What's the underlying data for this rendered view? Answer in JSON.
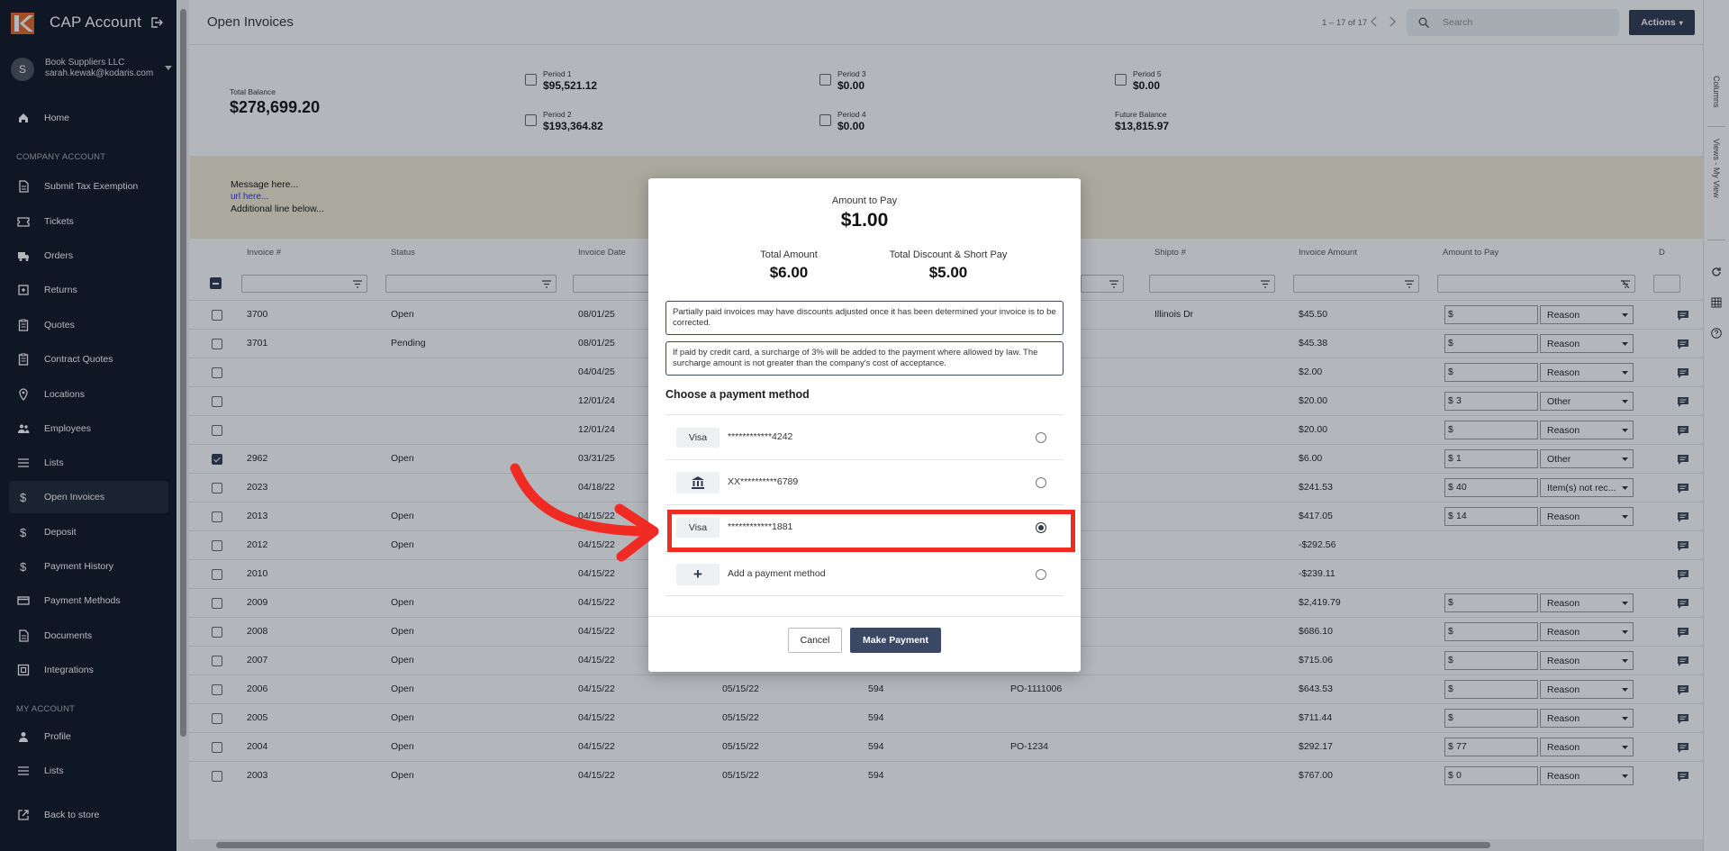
{
  "sidebar": {
    "app_title": "CAP Account",
    "account_name": "Book Suppliers LLC",
    "account_email": "sarah.kewak@kodaris.com",
    "avatar_letter": "S",
    "section_company": "COMPANY ACCOUNT",
    "section_my": "MY ACCOUNT",
    "items": [
      {
        "label": "Home",
        "icon": "home-icon"
      },
      {
        "label": "Submit Tax Exemption",
        "icon": "document-icon"
      },
      {
        "label": "Tickets",
        "icon": "ticket-icon"
      },
      {
        "label": "Orders",
        "icon": "truck-icon"
      },
      {
        "label": "Returns",
        "icon": "return-box-icon"
      },
      {
        "label": "Quotes",
        "icon": "clipboard-icon"
      },
      {
        "label": "Contract Quotes",
        "icon": "clipboard-icon"
      },
      {
        "label": "Locations",
        "icon": "location-pin-icon"
      },
      {
        "label": "Employees",
        "icon": "people-icon"
      },
      {
        "label": "Lists",
        "icon": "list-icon"
      },
      {
        "label": "Open Invoices",
        "icon": "dollar-icon"
      },
      {
        "label": "Deposit",
        "icon": "dollar-icon"
      },
      {
        "label": "Payment History",
        "icon": "dollar-icon"
      },
      {
        "label": "Payment Methods",
        "icon": "credit-card-icon"
      },
      {
        "label": "Documents",
        "icon": "document-icon"
      },
      {
        "label": "Integrations",
        "icon": "integration-icon"
      }
    ],
    "my_items": [
      {
        "label": "Profile",
        "icon": "person-icon"
      },
      {
        "label": "Lists",
        "icon": "list-icon"
      }
    ],
    "back_to_store": "Back to store",
    "active_item": "Open Invoices"
  },
  "header": {
    "title": "Open Invoices",
    "pager": "1 – 17 of 17",
    "search_placeholder": "Search",
    "actions_label": "Actions"
  },
  "summary": {
    "total_balance_label": "Total Balance",
    "total_balance": "$278,699.20",
    "period1_label": "Period 1",
    "period1": "$95,521.12",
    "period2_label": "Period 2",
    "period2": "$193,364.82",
    "period3_label": "Period 3",
    "period3": "$0.00",
    "period4_label": "Period 4",
    "period4": "$0.00",
    "period5_label": "Period 5",
    "period5": "$0.00",
    "future_label": "Future Balance",
    "future": "$13,815.97"
  },
  "banner": {
    "line1": "Message here...",
    "line2": "url here...",
    "line3": "Additional line below..."
  },
  "table": {
    "columns": [
      "Invoice #",
      "Status",
      "Invoice Date",
      "Shipto #",
      "Invoice Amount",
      "Amount to Pay",
      "D"
    ],
    "rows": [
      {
        "invoice": "3700",
        "status": "Open",
        "date": "08/01/25",
        "due": "",
        "terms": "",
        "po": "",
        "shipto": "Illinois Dr",
        "amount": "$45.50",
        "pay": "",
        "reason": "Reason",
        "checked": false,
        "has_pay": true
      },
      {
        "invoice": "3701",
        "status": "Pending",
        "date": "08/01/25",
        "due": "",
        "terms": "",
        "po": "",
        "shipto": "",
        "amount": "$45.38",
        "pay": "",
        "reason": "Reason",
        "checked": false,
        "has_pay": true
      },
      {
        "invoice": "",
        "status": "",
        "date": "04/04/25",
        "due": "",
        "terms": "",
        "po": "",
        "shipto": "",
        "amount": "$2.00",
        "pay": "",
        "reason": "Reason",
        "checked": false,
        "has_pay": true
      },
      {
        "invoice": "",
        "status": "",
        "date": "12/01/24",
        "due": "",
        "terms": "",
        "po": "",
        "shipto": "",
        "amount": "$20.00",
        "pay": "3",
        "reason": "Other",
        "checked": false,
        "has_pay": true
      },
      {
        "invoice": "",
        "status": "",
        "date": "12/01/24",
        "due": "",
        "terms": "",
        "po": "",
        "shipto": "",
        "amount": "$20.00",
        "pay": "",
        "reason": "Reason",
        "checked": false,
        "has_pay": true
      },
      {
        "invoice": "2962",
        "status": "Open",
        "date": "03/31/25",
        "due": "",
        "terms": "",
        "po": "",
        "shipto": "",
        "amount": "$6.00",
        "pay": "1",
        "reason": "Other",
        "checked": true,
        "has_pay": true
      },
      {
        "invoice": "2023",
        "status": "",
        "date": "04/18/22",
        "due": "",
        "terms": "",
        "po": "",
        "shipto": "",
        "amount": "$241.53",
        "pay": "40",
        "reason": "Item(s) not rec...",
        "checked": false,
        "has_pay": true
      },
      {
        "invoice": "2013",
        "status": "Open",
        "date": "04/15/22",
        "due": "",
        "terms": "",
        "po": "",
        "shipto": "",
        "amount": "$417.05",
        "pay": "14",
        "reason": "Reason",
        "checked": false,
        "has_pay": true
      },
      {
        "invoice": "2012",
        "status": "Open",
        "date": "04/15/22",
        "due": "",
        "terms": "",
        "po": "",
        "shipto": "",
        "amount": "-$292.56",
        "pay": "",
        "reason": "",
        "checked": false,
        "has_pay": false
      },
      {
        "invoice": "2010",
        "status": "",
        "date": "04/15/22",
        "due": "",
        "terms": "",
        "po": "",
        "shipto": "",
        "amount": "-$239.11",
        "pay": "",
        "reason": "",
        "checked": false,
        "has_pay": false
      },
      {
        "invoice": "2009",
        "status": "Open",
        "date": "04/15/22",
        "due": "",
        "terms": "",
        "po": "",
        "shipto": "",
        "amount": "$2,419.79",
        "pay": "",
        "reason": "Reason",
        "checked": false,
        "has_pay": true
      },
      {
        "invoice": "2008",
        "status": "Open",
        "date": "04/15/22",
        "due": "",
        "terms": "",
        "po": "",
        "shipto": "",
        "amount": "$686.10",
        "pay": "",
        "reason": "Reason",
        "checked": false,
        "has_pay": true
      },
      {
        "invoice": "2007",
        "status": "Open",
        "date": "04/15/22",
        "due": "",
        "terms": "",
        "po": "",
        "shipto": "",
        "amount": "$715.06",
        "pay": "",
        "reason": "Reason",
        "checked": false,
        "has_pay": true
      },
      {
        "invoice": "2006",
        "status": "Open",
        "date": "04/15/22",
        "due": "05/15/22",
        "terms": "594",
        "po": "PO-1111006",
        "shipto": "",
        "amount": "$643.53",
        "pay": "",
        "reason": "Reason",
        "checked": false,
        "has_pay": true
      },
      {
        "invoice": "2005",
        "status": "Open",
        "date": "04/15/22",
        "due": "05/15/22",
        "terms": "594",
        "po": "",
        "shipto": "",
        "amount": "$711.44",
        "pay": "",
        "reason": "Reason",
        "checked": false,
        "has_pay": true
      },
      {
        "invoice": "2004",
        "status": "Open",
        "date": "04/15/22",
        "due": "05/15/22",
        "terms": "594",
        "po": "PO-1234",
        "shipto": "",
        "amount": "$292.17",
        "pay": "77",
        "reason": "Reason",
        "checked": false,
        "has_pay": true
      },
      {
        "invoice": "2003",
        "status": "Open",
        "date": "04/15/22",
        "due": "05/15/22",
        "terms": "594",
        "po": "",
        "shipto": "",
        "amount": "$767.00",
        "pay": "0",
        "reason": "Reason",
        "checked": false,
        "has_pay": true
      }
    ],
    "dollar_sign": "$"
  },
  "right_rail": {
    "columns_label": "Columns",
    "views_label": "Views - My View"
  },
  "modal": {
    "amount_to_pay_label": "Amount to Pay",
    "amount_to_pay": "$1.00",
    "total_amount_label": "Total Amount",
    "total_amount": "$6.00",
    "total_discount_label": "Total Discount & Short Pay",
    "total_discount": "$5.00",
    "note1": "Partially paid invoices may have discounts adjusted once it has been determined your invoice is to be corrected.",
    "note2": "If paid by credit card, a surcharge of 3% will be added to the payment where allowed by law. The surcharge amount is not greater than the company's cost of acceptance.",
    "choose_label": "Choose a payment method",
    "methods": [
      {
        "badge": "Visa",
        "number": "************4242",
        "selected": false
      },
      {
        "badge": "",
        "number": "XX**********6789",
        "selected": false
      },
      {
        "badge": "Visa",
        "number": "************1881",
        "selected": true
      },
      {
        "badge": "",
        "number": "Add a payment method",
        "selected": false
      }
    ],
    "cancel_label": "Cancel",
    "make_payment_label": "Make Payment"
  },
  "colors": {
    "sidebar_bg": "#0e1622",
    "accent": "#2f3a52",
    "banner_bg": "#f3ecd6",
    "highlight": "#ef2b24"
  }
}
